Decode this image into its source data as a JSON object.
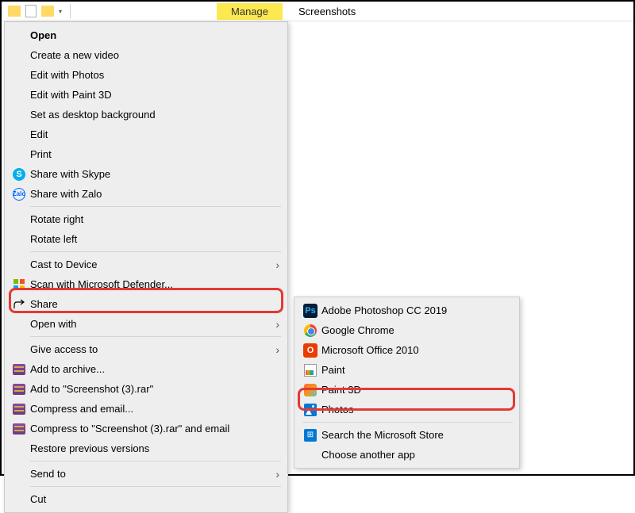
{
  "titlebar": {
    "ribbon_tab": "Manage",
    "window_title": "Screenshots"
  },
  "context_menu": {
    "open": "Open",
    "create_video": "Create a new video",
    "edit_photos": "Edit with Photos",
    "edit_paint3d": "Edit with Paint 3D",
    "set_bg": "Set as desktop background",
    "edit": "Edit",
    "print": "Print",
    "share_skype": "Share with Skype",
    "share_zalo": "Share with Zalo",
    "rotate_right": "Rotate right",
    "rotate_left": "Rotate left",
    "cast": "Cast to Device",
    "scan_defender": "Scan with Microsoft Defender...",
    "share": "Share",
    "open_with": "Open with",
    "give_access": "Give access to",
    "add_archive": "Add to archive...",
    "add_rar": "Add to \"Screenshot (3).rar\"",
    "compress_email": "Compress and email...",
    "compress_rar_email": "Compress to \"Screenshot (3).rar\" and email",
    "restore": "Restore previous versions",
    "send_to": "Send to",
    "cut": "Cut"
  },
  "submenu": {
    "photoshop": "Adobe Photoshop CC 2019",
    "chrome": "Google Chrome",
    "office": "Microsoft Office 2010",
    "paint": "Paint",
    "paint3d": "Paint 3D",
    "photos": "Photos",
    "search_store": "Search the Microsoft Store",
    "choose_another": "Choose another app"
  }
}
